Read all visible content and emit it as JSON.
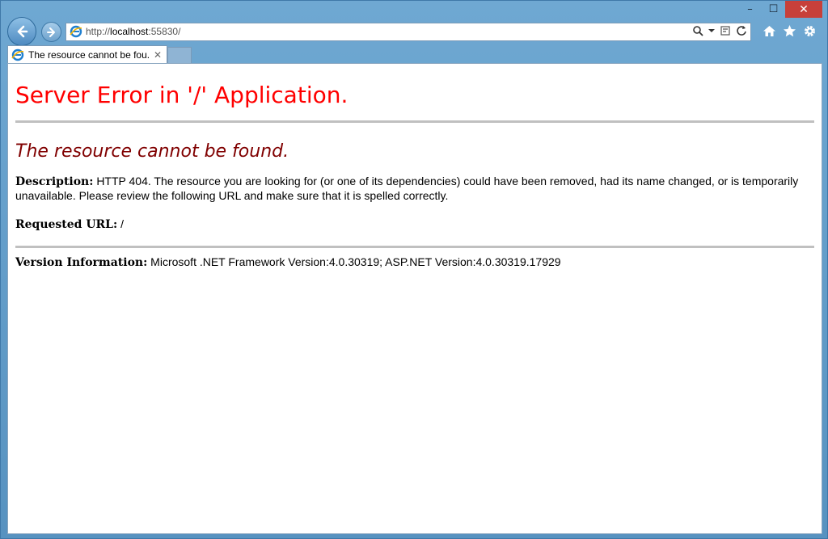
{
  "window": {
    "minimize": "–",
    "maximize": "☐",
    "close": "✕"
  },
  "address_bar": {
    "url_prefix": "http://",
    "url_host": "localhost",
    "url_port": ":55830/"
  },
  "tab": {
    "title": "The resource cannot be fou...",
    "close": "✕"
  },
  "page": {
    "heading": "Server Error in '/' Application.",
    "subheading": "The resource cannot be found.",
    "description_label": "Description:",
    "description_text": "HTTP 404. The resource you are looking for (or one of its dependencies) could have been removed, had its name changed, or is temporarily unavailable.  Please review the following URL and make sure that it is spelled correctly.",
    "requested_url_label": "Requested URL:",
    "requested_url_value": "/",
    "version_label": "Version Information:",
    "version_text": "Microsoft .NET Framework Version:4.0.30319; ASP.NET Version:4.0.30319.17929"
  },
  "colors": {
    "heading": "#ff0000",
    "subheading": "#800000",
    "close_button": "#c7403a"
  },
  "icons": {
    "back": "arrow-left-icon",
    "forward": "arrow-right-icon",
    "search": "search-icon",
    "compat": "compatibility-view-icon",
    "refresh": "refresh-icon",
    "home": "home-icon",
    "favorites": "star-icon",
    "tools": "gear-icon"
  }
}
